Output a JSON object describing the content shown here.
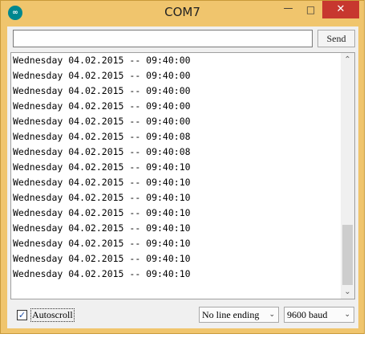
{
  "window": {
    "title": "COM7",
    "icon": "arduino-infinity-icon"
  },
  "title_controls": {
    "minimize": "—",
    "maximize": "□",
    "close": "✕"
  },
  "send": {
    "input_value": "",
    "button_label": "Send"
  },
  "output_lines": [
    "Wednesday 04.02.2015 -- 09:40:00",
    "Wednesday 04.02.2015 -- 09:40:00",
    "Wednesday 04.02.2015 -- 09:40:00",
    "Wednesday 04.02.2015 -- 09:40:00",
    "Wednesday 04.02.2015 -- 09:40:00",
    "Wednesday 04.02.2015 -- 09:40:08",
    "Wednesday 04.02.2015 -- 09:40:08",
    "Wednesday 04.02.2015 -- 09:40:10",
    "Wednesday 04.02.2015 -- 09:40:10",
    "Wednesday 04.02.2015 -- 09:40:10",
    "Wednesday 04.02.2015 -- 09:40:10",
    "Wednesday 04.02.2015 -- 09:40:10",
    "Wednesday 04.02.2015 -- 09:40:10",
    "Wednesday 04.02.2015 -- 09:40:10",
    "Wednesday 04.02.2015 -- 09:40:10"
  ],
  "scrollbar": {
    "up": "⌃",
    "down": "⌄"
  },
  "footer": {
    "autoscroll_label": "Autoscroll",
    "autoscroll_checked": true,
    "line_ending": "No line ending",
    "baud": "9600 baud"
  },
  "colors": {
    "frame": "#f0c56d",
    "close_button": "#c7372f",
    "app_icon": "#00878f"
  }
}
